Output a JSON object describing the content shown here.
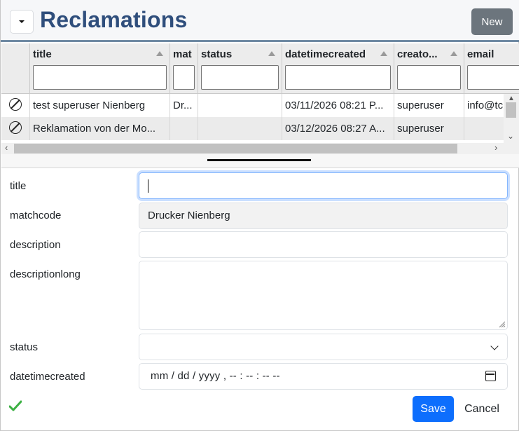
{
  "header": {
    "title": "Reclamations",
    "new_label": "New"
  },
  "grid": {
    "columns": [
      {
        "key": "title",
        "label": "title"
      },
      {
        "key": "matchcode",
        "label": "mat"
      },
      {
        "key": "status",
        "label": "status"
      },
      {
        "key": "datetimecreated",
        "label": "datetimecreated"
      },
      {
        "key": "creator",
        "label": "creato..."
      },
      {
        "key": "email",
        "label": "email"
      }
    ],
    "rows": [
      {
        "title": "test superuser Nienberg",
        "matchcode": "Dr...",
        "status": "",
        "datetimecreated": "03/11/2026 08:21 P...",
        "creator": "superuser",
        "email": "info@tc"
      },
      {
        "title": "Reklamation von der Mo...",
        "matchcode": "",
        "status": "",
        "datetimecreated": "03/12/2026 08:27 A...",
        "creator": "superuser",
        "email": ""
      }
    ]
  },
  "form": {
    "title_label": "title",
    "title_value": "",
    "matchcode_label": "matchcode",
    "matchcode_value": "Drucker Nienberg",
    "description_label": "description",
    "description_value": "",
    "descriptionlong_label": "descriptionlong",
    "descriptionlong_value": "",
    "status_label": "status",
    "status_value": "",
    "datetimecreated_label": "datetimecreated",
    "datetimecreated_value": "mm / dd / yyyy ,  -- : -- : --   --"
  },
  "actions": {
    "save_label": "Save",
    "cancel_label": "Cancel"
  },
  "colors": {
    "title": "#2f4e7c",
    "primary": "#0d6efd",
    "secondary": "#6c757d",
    "success_check": "#3cb043"
  }
}
